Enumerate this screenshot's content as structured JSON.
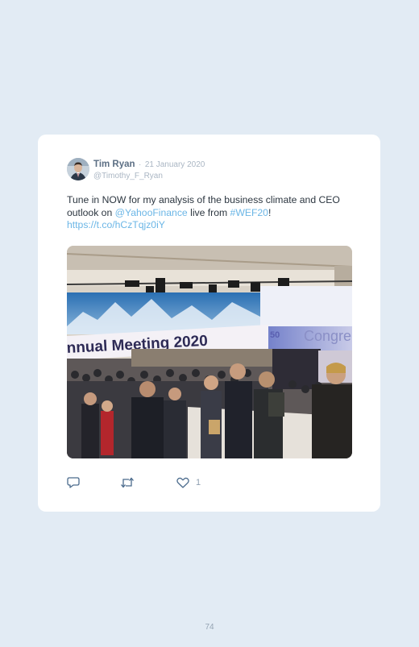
{
  "tweet": {
    "author_name": "Tim Ryan",
    "separator": "·",
    "date": "21 January 2020",
    "handle": "@Timothy_F_Ryan",
    "text_before_mention": "Tune in NOW for my analysis of the business climate and CEO outlook on ",
    "mention": "@YahooFinance",
    "text_middle": " live from ",
    "hashtag": "#WEF20",
    "text_after_hashtag": "!",
    "url": "https://t.co/hCzTqjz0iY",
    "banner_text": "nnual Meeting 2020",
    "venue_text": "Congre",
    "venue_badge": "50",
    "like_count": "1"
  },
  "icons": {
    "reply": "reply-icon",
    "retweet": "retweet-icon",
    "like": "heart-icon"
  },
  "colors": {
    "background": "#e2ebf4",
    "card": "#ffffff",
    "link": "#6bb6e6",
    "name": "#5c6f84",
    "muted": "#aab6c3"
  },
  "page": {
    "number": "74"
  }
}
